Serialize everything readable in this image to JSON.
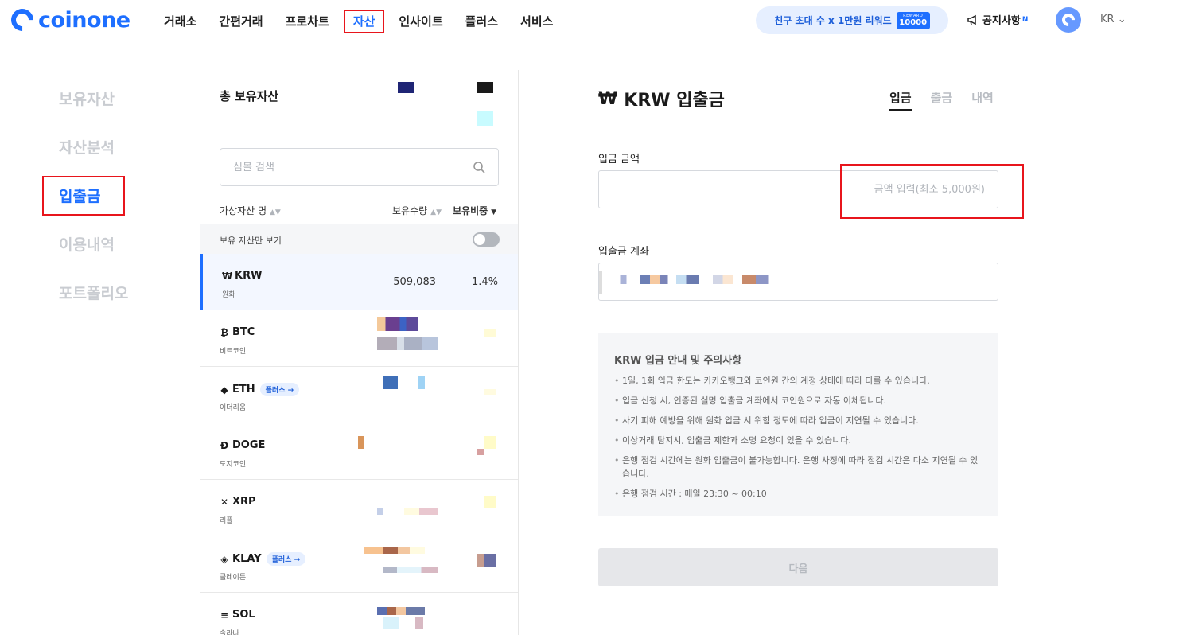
{
  "header": {
    "logo_text": "coinone",
    "nav": [
      "거래소",
      "간편거래",
      "프로차트",
      "자산",
      "인사이트",
      "플러스",
      "서비스"
    ],
    "active_nav": "자산",
    "referral_text": "친구 초대 수 x 1만원 리워드",
    "reward_label": "REWARD",
    "reward_value": "10000",
    "notice_label": "공지사항",
    "notice_badge": "N",
    "lang": "KR"
  },
  "sidebar": {
    "items": [
      "보유자산",
      "자산분석",
      "입출금",
      "이용내역",
      "포트폴리오"
    ],
    "active": "입출금"
  },
  "assets": {
    "total_label": "총 보유자산",
    "search_placeholder": "심볼 검색",
    "col_name": "가상자산 명",
    "col_qty": "보유수량",
    "col_ratio": "보유비중",
    "toggle_label": "보유 자산만 보기",
    "toggle_on": false,
    "plus_badge": "플러스 →",
    "rows": [
      {
        "symbol": "KRW",
        "name": "원화",
        "icon": "₩",
        "qty": "509,083",
        "ratio": "1.4%",
        "plus": false
      },
      {
        "symbol": "BTC",
        "name": "비트코인",
        "icon": "₿",
        "qty": "",
        "ratio": "",
        "plus": false
      },
      {
        "symbol": "ETH",
        "name": "이더리움",
        "icon": "◆",
        "qty": "",
        "ratio": "",
        "plus": true
      },
      {
        "symbol": "DOGE",
        "name": "도지코인",
        "icon": "Ð",
        "qty": "",
        "ratio": "",
        "plus": false
      },
      {
        "symbol": "XRP",
        "name": "리플",
        "icon": "✕",
        "qty": "",
        "ratio": "",
        "plus": false
      },
      {
        "symbol": "KLAY",
        "name": "클레이튼",
        "icon": "◈",
        "qty": "",
        "ratio": "",
        "plus": true
      },
      {
        "symbol": "SOL",
        "name": "솔라나",
        "icon": "≡",
        "qty": "",
        "ratio": "",
        "plus": false
      }
    ]
  },
  "deposit": {
    "title_icon": "₩",
    "title": "KRW 입출금",
    "tabs": [
      "입금",
      "출금",
      "내역"
    ],
    "active_tab": "입금",
    "amount_label": "입금 금액",
    "amount_placeholder": "금액 입력(최소 5,000원)",
    "account_label": "입출금 계좌",
    "notice_title": "KRW 입금 안내 및 주의사항",
    "notices": [
      "1일, 1회 입금 한도는 카카오뱅크와 코인원 간의 계정 상태에 따라 다를 수 있습니다.",
      "입금 신청 시, 인증된 실명 입출금 계좌에서 코인원으로 자동 이체됩니다.",
      "사기 피해 예방을 위해 원화 입금 시 위험 정도에 따라 입금이 지연될 수 있습니다.",
      "이상거래 탐지시, 입출금 제한과 소명 요청이 있을 수 있습니다.",
      "은행 점검 시간에는 원화 입출금이 불가능합니다. 은행 사정에 따라 점검 시간은 다소 지연될 수 있습니다.",
      "은행 점검 시간 : 매일 23:30 ~ 00:10"
    ],
    "next_label": "다음"
  },
  "colors": {
    "brand": "#1e6fff",
    "highlight": "#e8151c"
  }
}
